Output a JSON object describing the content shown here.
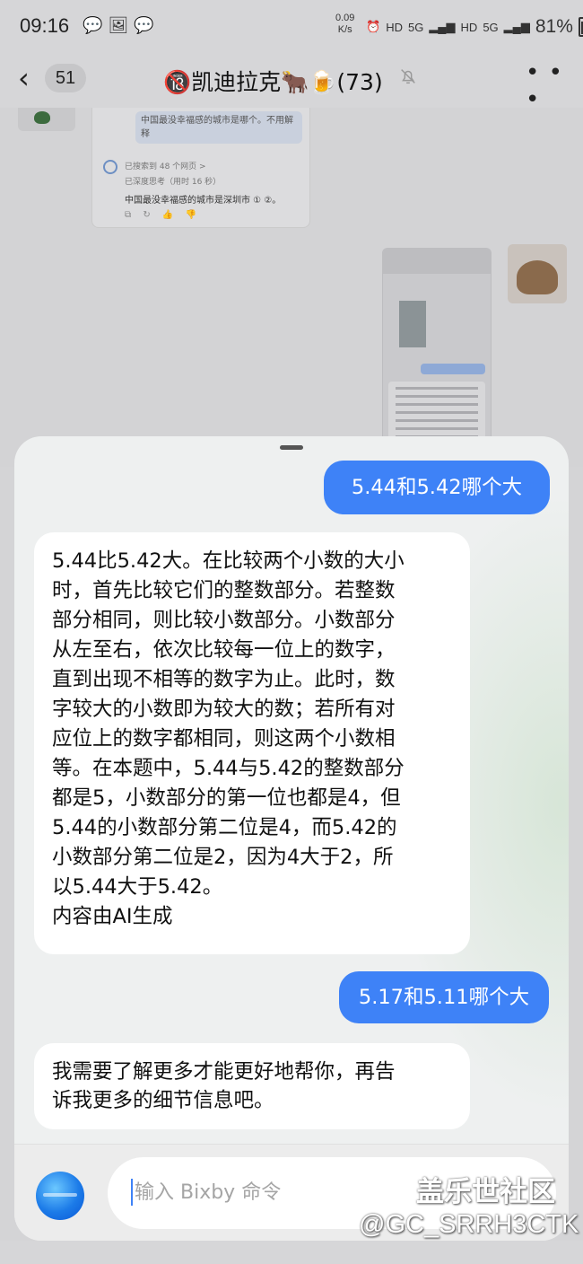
{
  "status_bar": {
    "time": "09:16",
    "net_speed_value": "0.09",
    "net_speed_unit": "K/s",
    "sim1": "HD",
    "sim1_net": "5G",
    "sim2": "HD",
    "sim2_net": "5G",
    "battery": "81%",
    "icons": [
      "chat-bubble-icon",
      "image-icon",
      "chat-bubble-icon",
      "alarm-icon",
      "signal-icon",
      "battery-icon"
    ]
  },
  "header": {
    "unread_count": "51",
    "chat_title": "🔞凯迪拉克🐂🍺(73)",
    "icons": [
      "back-chevron-icon",
      "mute-bell-icon",
      "more-icon"
    ]
  },
  "background_chat": {
    "quoted_question": "中国最没幸福感的城市是哪个。不用解释",
    "search_meta": "已搜索到 48 个网页 >",
    "think_meta": "已深度思考（用时 16 秒）",
    "answer": "中国最没幸福感的城市是深圳市 ① ②。"
  },
  "sheet": {
    "messages": [
      {
        "role": "user",
        "text": "5.44和5.42哪个大"
      },
      {
        "role": "assistant",
        "lines": [
          "5.44比5.42大。在比较两个小数的大小",
          "时，首先比较它们的整数部分。若整数",
          "部分相同，则比较小数部分。小数部分",
          "从左至右，依次比较每一位上的数字，",
          "直到出现不相等的数字为止。此时，数",
          "字较大的小数即为较大的数；若所有对",
          "应位上的数字都相同，则这两个小数相",
          "等。在本题中，5.44与5.42的整数部分",
          "都是5，小数部分的第一位也都是4，但",
          "5.44的小数部分第二位是4，而5.42的",
          "小数部分第二位是2，因为4大于2，所",
          "以5.44大于5.42。",
          "内容由AI生成"
        ]
      },
      {
        "role": "user",
        "text": "5.17和5.11哪个大"
      },
      {
        "role": "assistant",
        "lines": [
          "我需要了解更多才能更好地帮你，再告",
          "诉我更多的细节信息吧。"
        ]
      }
    ],
    "input_placeholder": "输入 Bixby 命令"
  },
  "watermark": {
    "site": "盖乐世社区",
    "user": "@GC_SRRH3CTK"
  }
}
